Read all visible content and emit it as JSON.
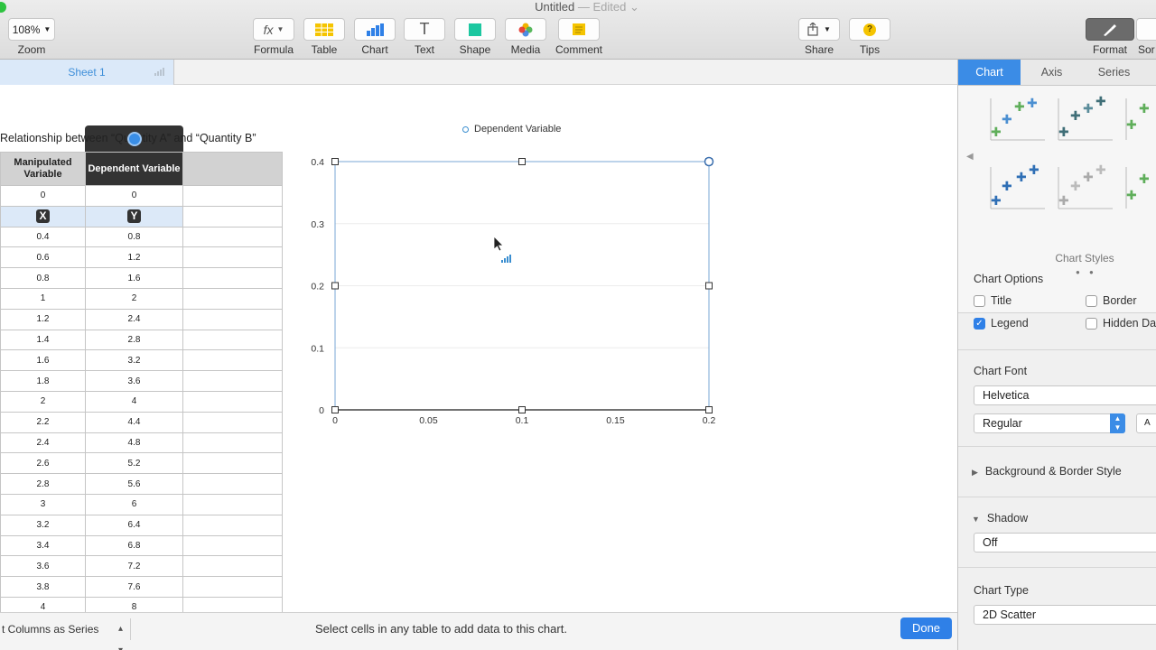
{
  "window": {
    "title": "Untitled",
    "status": "— Edited"
  },
  "toolbar": {
    "zoom_value": "108%",
    "zoom_label": "Zoom",
    "formula_label": "Formula",
    "table_label": "Table",
    "chart_label": "Chart",
    "text_label": "Text",
    "shape_label": "Shape",
    "media_label": "Media",
    "comment_label": "Comment",
    "share_label": "Share",
    "tips_label": "Tips",
    "format_label": "Format",
    "sort_label": "Sor",
    "formula_glyph": "fx",
    "text_glyph": "T",
    "tips_glyph": "?"
  },
  "sheet": {
    "tab_label": "Sheet 1"
  },
  "table": {
    "title": "Relationship between “Quantity A” and “Quantity B”",
    "headers": [
      "Manipulated Variable",
      "Dependent Variable"
    ],
    "rows": [
      [
        "0",
        "0"
      ],
      [
        "X",
        "Y"
      ],
      [
        "0.4",
        "0.8"
      ],
      [
        "0.6",
        "1.2"
      ],
      [
        "0.8",
        "1.6"
      ],
      [
        "1",
        "2"
      ],
      [
        "1.2",
        "2.4"
      ],
      [
        "1.4",
        "2.8"
      ],
      [
        "1.6",
        "3.2"
      ],
      [
        "1.8",
        "3.6"
      ],
      [
        "2",
        "4"
      ],
      [
        "2.2",
        "4.4"
      ],
      [
        "2.4",
        "4.8"
      ],
      [
        "2.6",
        "5.2"
      ],
      [
        "2.8",
        "5.6"
      ],
      [
        "3",
        "6"
      ],
      [
        "3.2",
        "6.4"
      ],
      [
        "3.4",
        "6.8"
      ],
      [
        "3.6",
        "7.2"
      ],
      [
        "3.8",
        "7.6"
      ],
      [
        "4",
        "8"
      ]
    ]
  },
  "chart_data": {
    "type": "scatter",
    "title": "",
    "xlabel": "",
    "ylabel": "",
    "xlim": [
      0,
      0.2
    ],
    "ylim": [
      0,
      0.4
    ],
    "xticks": [
      "0",
      "0.05",
      "0.1",
      "0.15",
      "0.2"
    ],
    "yticks": [
      "0",
      "0.1",
      "0.2",
      "0.3",
      "0.4"
    ],
    "grid": true,
    "legend": "top-center",
    "series": [
      {
        "name": "Dependent Variable",
        "x": [],
        "y": [],
        "color": "#3a8ed0"
      }
    ]
  },
  "bottom": {
    "series_option": "t Columns as Series",
    "hint": "Select cells in any table to add data to this chart.",
    "done_label": "Done"
  },
  "inspector": {
    "tabs": [
      "Chart",
      "Axis",
      "Series"
    ],
    "styles_caption": "Chart Styles",
    "chart_options_title": "Chart Options",
    "options": [
      {
        "label": "Title",
        "checked": false
      },
      {
        "label": "Border",
        "checked": false
      },
      {
        "label": "Legend",
        "checked": true
      },
      {
        "label": "Hidden Da",
        "checked": false
      }
    ],
    "chart_font_title": "Chart Font",
    "font_name": "Helvetica",
    "font_style": "Regular",
    "font_size_glyph": "A",
    "background_border": "Background & Border Style",
    "shadow_title": "Shadow",
    "shadow_value": "Off",
    "chart_type_title": "Chart Type",
    "chart_type_value": "2D Scatter"
  },
  "colors": {
    "accent": "#2f80e7",
    "selection": "#dce9f8",
    "header_dark": "#333333"
  }
}
